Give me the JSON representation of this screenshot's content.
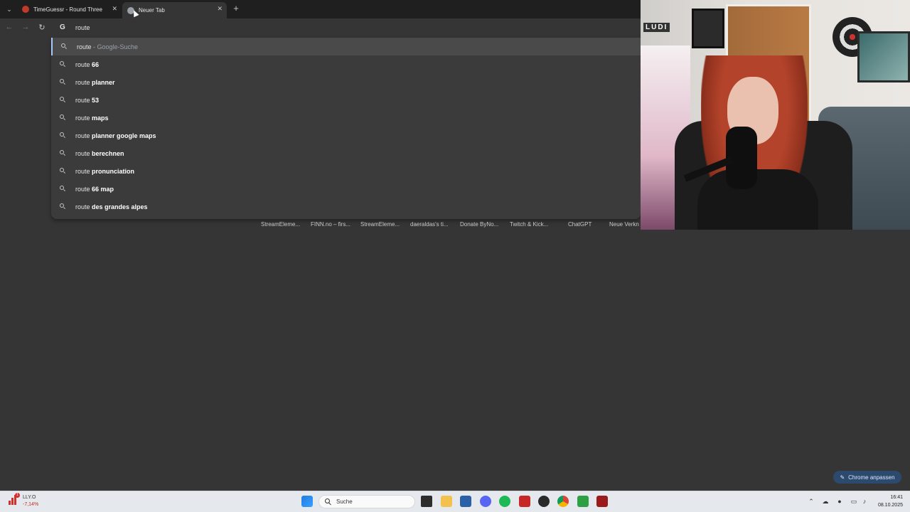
{
  "browser": {
    "tabs": [
      {
        "title": "TimeGuessr - Round Three",
        "favicon": "timeguessr-icon",
        "active": false
      },
      {
        "title": "Neuer Tab",
        "favicon": "chrome-newtab-icon",
        "active": true
      }
    ],
    "close_glyph": "✕",
    "new_tab_glyph": "+",
    "tab_menu_glyph": "⌄",
    "nav": {
      "back": "←",
      "forward": "→",
      "reload": "↻"
    },
    "omnibox": {
      "engine_glyph": "G",
      "value": "route"
    }
  },
  "suggestions": [
    {
      "prefix": "route",
      "suffix": "",
      "dim": " - Google-Suche"
    },
    {
      "prefix": "route",
      "suffix": " 66",
      "dim": ""
    },
    {
      "prefix": "route",
      "suffix": " planner",
      "dim": ""
    },
    {
      "prefix": "route",
      "suffix": " 53",
      "dim": ""
    },
    {
      "prefix": "route",
      "suffix": " maps",
      "dim": ""
    },
    {
      "prefix": "route",
      "suffix": " planner google maps",
      "dim": ""
    },
    {
      "prefix": "route",
      "suffix": " berechnen",
      "dim": ""
    },
    {
      "prefix": "route",
      "suffix": " pronunciation",
      "dim": ""
    },
    {
      "prefix": "route",
      "suffix": " 66 map",
      "dim": ""
    },
    {
      "prefix": "route",
      "suffix": " des grandes alpes",
      "dim": ""
    }
  ],
  "shortcuts": [
    "StreamEleme...",
    "FINN.no – firs...",
    "StreamEleme...",
    "daeraldas's ti...",
    "Donate ByNo...",
    "Twitch & Kick...",
    "ChatGPT",
    "Neue Verkn"
  ],
  "webcam": {
    "sign": "LUDI"
  },
  "customize_button": {
    "label": "Chrome anpassen",
    "icon": "pencil-icon"
  },
  "taskbar": {
    "stock": {
      "name": "LLY.O",
      "change": "-7,14%",
      "badge": "1"
    },
    "search_label": "Suche",
    "apps": [
      "windows-start-icon",
      "task-view-icon",
      "file-explorer-icon",
      "store-icon",
      "discord-icon",
      "spotify-icon",
      "app-icon",
      "obs-icon",
      "chrome-icon",
      "xbox-icon",
      "visual-studio-icon"
    ],
    "tray": [
      "chevron-up-icon",
      "cloud-icon",
      "microphone-icon",
      "display-icon",
      "speaker-icon"
    ],
    "time": "16:41",
    "date": "08.10.2025"
  },
  "colors": {
    "accent": "#a8c7fa",
    "background": "#353535"
  }
}
